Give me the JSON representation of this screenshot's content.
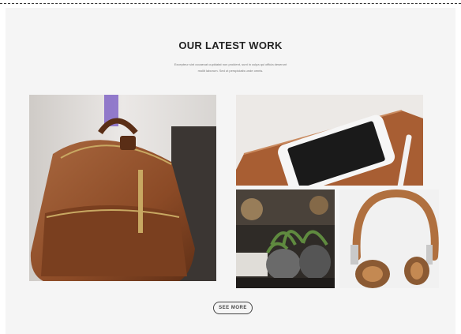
{
  "section": {
    "title": "OUR LATEST WORK",
    "subtitle_line1": "Excepteur sint occaecat cupidatat non proident, sunt in culpa qui officia deserunt",
    "subtitle_line2": "mollit laborum. Sed ut perspiciatis unde omnis."
  },
  "gallery": {
    "items": [
      {
        "subject": "leather backpack"
      },
      {
        "subject": "tablet with smartphone and stylus"
      },
      {
        "subject": "potted succulents"
      },
      {
        "subject": "headphones"
      }
    ]
  },
  "actions": {
    "see_more_label": "SEE MORE"
  },
  "colors": {
    "panel_bg": "#f5f5f5",
    "title": "#222222",
    "leather": "#8b4a26"
  }
}
